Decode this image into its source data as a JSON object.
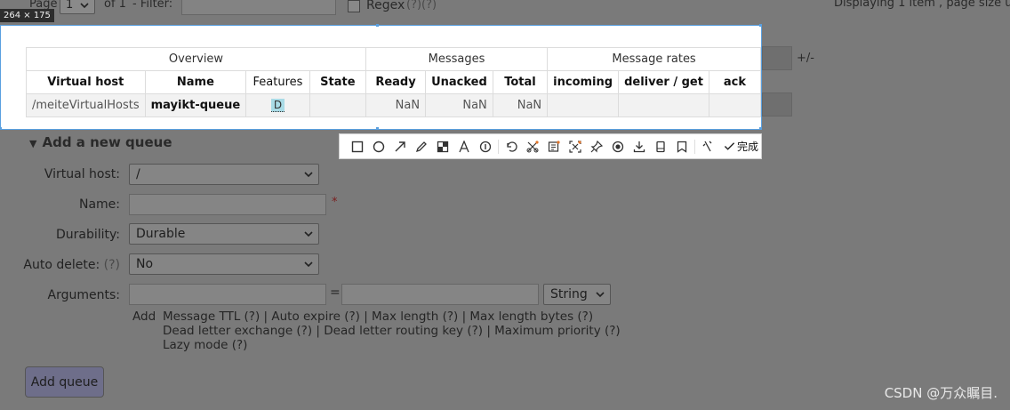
{
  "pager": {
    "page_label": "Page",
    "page_value": "1",
    "of_label": "of 1",
    "filter_label": "- Filter:",
    "regex_label": "Regex",
    "regex_help": "(?)(?)",
    "displaying": "Displaying 1 item , page size u"
  },
  "capture": {
    "size_badge": "264 × 175"
  },
  "table": {
    "groups": [
      "Overview",
      "Messages",
      "Message rates"
    ],
    "columns": [
      "Virtual host",
      "Name",
      "Features",
      "State",
      "Ready",
      "Unacked",
      "Total",
      "incoming",
      "deliver / get",
      "ack"
    ],
    "plus_minus": "+/-",
    "row": {
      "vhost": "/meiteVirtualHosts",
      "name": "mayikt-queue",
      "feature": "D",
      "state": "",
      "ready": "NaN",
      "unacked": "NaN",
      "total": "NaN"
    }
  },
  "toolbar": {
    "icons": [
      "rectangle-icon",
      "circle-icon",
      "arrow-icon",
      "pen-icon",
      "mosaic-icon",
      "text-icon",
      "number-icon",
      "undo-icon",
      "screenshot-icon",
      "ocr-icon",
      "scan-icon",
      "pin-icon",
      "record-icon",
      "download-icon",
      "long-screenshot-icon",
      "save-icon",
      "cancel-icon"
    ],
    "done_label": "完成"
  },
  "form": {
    "section_title": "Add a new queue",
    "vhost_label": "Virtual host:",
    "vhost_value": "/",
    "name_label": "Name:",
    "name_required": "*",
    "durability_label": "Durability:",
    "durability_value": "Durable",
    "autodelete_label": "Auto delete:",
    "autodelete_help": "(?)",
    "autodelete_value": "No",
    "arguments_label": "Arguments:",
    "equals": "=",
    "type_value": "String",
    "add_label": "Add",
    "hints_line1": "Message TTL (?) | Auto expire (?) | Max length (?) | Max length bytes (?)",
    "hints_line2": "Dead letter exchange (?) | Dead letter routing key (?) | Maximum priority (?)",
    "hints_line3": "Lazy mode (?)",
    "add_queue_button": "Add queue"
  },
  "watermark": "CSDN @万众瞩目."
}
